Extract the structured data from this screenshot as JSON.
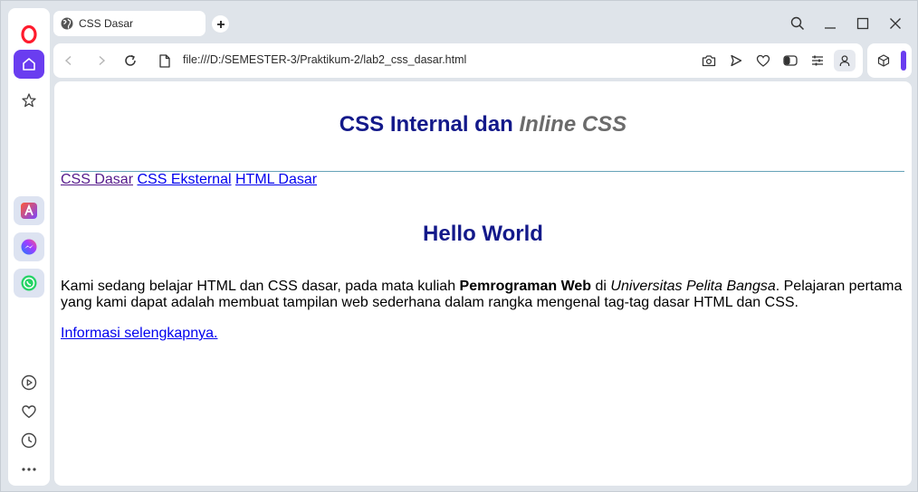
{
  "browser": {
    "tab_title": "CSS Dasar",
    "url": "file:///D:/SEMESTER-3/Praktikum-2/lab2_css_dasar.html",
    "accent_color": "#6a3df0",
    "opera_color": "#ff1b2d"
  },
  "sidebar": {
    "icons": [
      "opera-logo-icon",
      "home-icon",
      "star-icon",
      "aria-icon",
      "messenger-icon",
      "whatsapp-icon",
      "player-icon",
      "heart-icon",
      "history-icon",
      "more-icon"
    ]
  },
  "page": {
    "heading_part1": "CSS Internal dan ",
    "heading_part2": "Inline CSS",
    "nav_links": [
      "CSS Dasar",
      "CSS Eksternal",
      "HTML Dasar"
    ],
    "hello": "Hello World",
    "para_part1": "Kami sedang belajar HTML dan CSS dasar, pada mata kuliah ",
    "para_bold": "Pemrograman Web",
    "para_part2": " di ",
    "para_italic": "Universitas Pelita Bangsa",
    "para_part3": ". Pelajaran pertama yang kami dapat adalah membuat tampilan web sederhana dalam rangka mengenal tag-tag dasar HTML dan CSS.",
    "more_link": "Informasi selengkapnya."
  }
}
